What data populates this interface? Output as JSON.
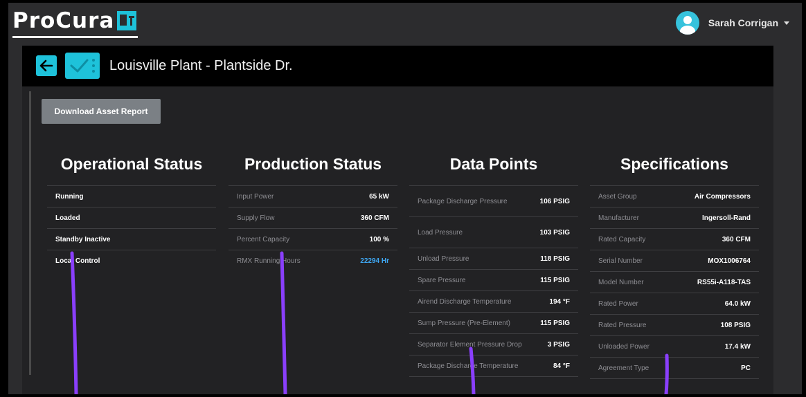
{
  "brand": {
    "name": "ProCura",
    "icon": "iot-mark-icon",
    "accent": "#1ec2da"
  },
  "user": {
    "name": "Sarah Corrigan",
    "icon": "user-avatar-icon"
  },
  "asset": {
    "title": "Louisville Plant - Plantside Dr.",
    "back_icon": "arrow-left-icon",
    "status_icon": "checkmark-icon"
  },
  "actions": {
    "download_report": "Download Asset Report"
  },
  "operational": {
    "title": "Operational Status",
    "rows": [
      "Running",
      "Loaded",
      "Standby Inactive",
      "Local Control"
    ]
  },
  "production": {
    "title": "Production Status",
    "rows": [
      {
        "label": "Input Power",
        "value": "65 kW"
      },
      {
        "label": "Supply Flow",
        "value": "360 CFM"
      },
      {
        "label": "Percent Capacity",
        "value": "100 %"
      },
      {
        "label": "RMX Running Hours",
        "value": "22294 Hr"
      }
    ]
  },
  "datapoints": {
    "title": "Data Points",
    "rows": [
      {
        "label": "Package Discharge Pressure",
        "value": "106 PSIG"
      },
      {
        "label": "Load Pressure",
        "value": "103 PSIG"
      },
      {
        "label": "Unload Pressure",
        "value": "118 PSIG"
      },
      {
        "label": "Spare Pressure",
        "value": "115 PSIG"
      },
      {
        "label": "Airend Discharge Temperature",
        "value": "194 °F"
      },
      {
        "label": "Sump Pressure (Pre-Element)",
        "value": "115 PSIG"
      },
      {
        "label": "Separator Element Pressure Drop",
        "value": "3 PSIG"
      },
      {
        "label": "Package Discharge Temperature",
        "value": "84 °F"
      }
    ]
  },
  "specifications": {
    "title": "Specifications",
    "rows": [
      {
        "label": "Asset Group",
        "value": "Air Compressors"
      },
      {
        "label": "Manufacturer",
        "value": "Ingersoll-Rand"
      },
      {
        "label": "Rated Capacity",
        "value": "360 CFM"
      },
      {
        "label": "Serial Number",
        "value": "MOX1006764"
      },
      {
        "label": "Model Number",
        "value": "RS55i-A118-TAS"
      },
      {
        "label": "Rated Power",
        "value": "64.0 kW"
      },
      {
        "label": "Rated Pressure",
        "value": "108 PSIG"
      },
      {
        "label": "Unloaded Power",
        "value": "17.4 kW"
      },
      {
        "label": "Agreement Type",
        "value": "PC"
      }
    ]
  },
  "colors": {
    "background": "#2c2c2e",
    "panel": "#222224",
    "header": "#000000",
    "link": "#3fa9f5",
    "annotation": "#8a3ffc"
  }
}
